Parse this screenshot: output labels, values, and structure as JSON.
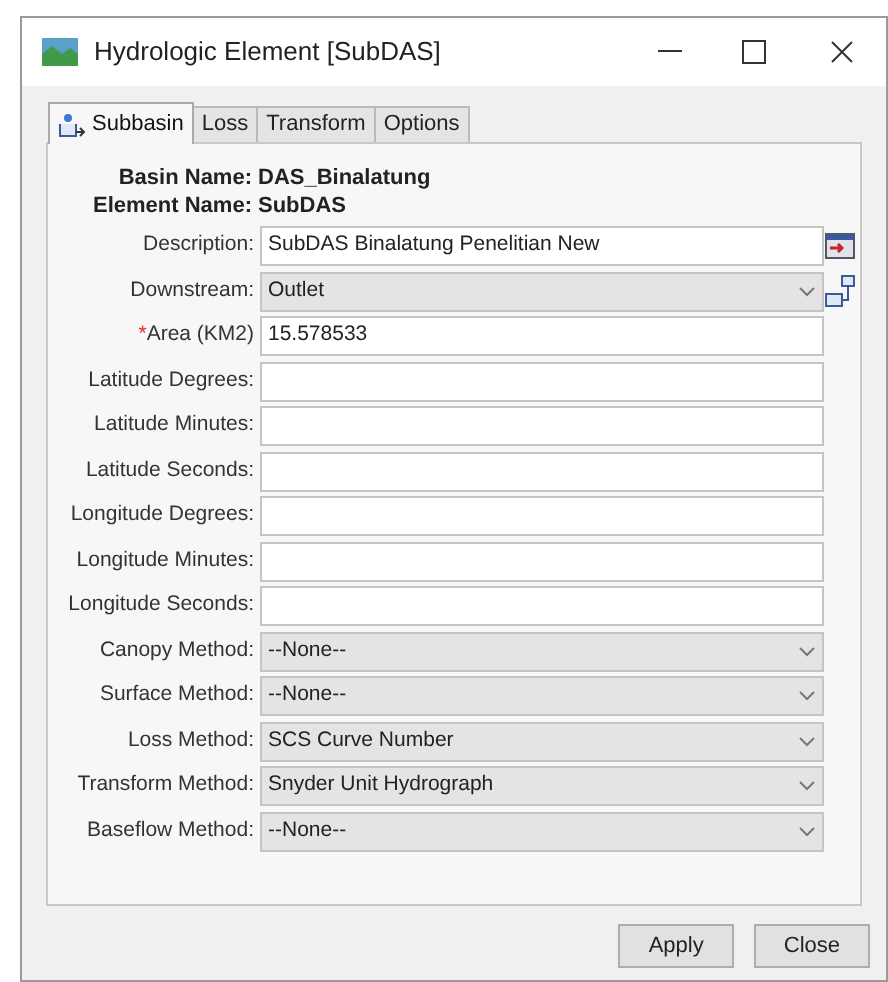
{
  "window": {
    "title": "Hydrologic Element [SubDAS]"
  },
  "tabs": [
    {
      "label": "Subbasin",
      "selected": true,
      "icon": true
    },
    {
      "label": "Loss",
      "selected": false
    },
    {
      "label": "Transform",
      "selected": false
    },
    {
      "label": "Options",
      "selected": false
    }
  ],
  "header": [
    {
      "label": "Basin Name:",
      "value": "DAS_Binalatung"
    },
    {
      "label": "Element Name:",
      "value": "SubDAS"
    }
  ],
  "fields": [
    {
      "label": "Description:",
      "kind": "text",
      "value": "SubDAS Binalatung Penelitian New",
      "side_button": {
        "kind": "form"
      }
    },
    {
      "label": "Downstream:",
      "kind": "select",
      "value": "Outlet",
      "side_button": {
        "kind": "database"
      }
    },
    {
      "label": "Area (KM2)",
      "kind": "text",
      "value": "15.578533",
      "required_mark": "*"
    },
    {
      "label": "Latitude Degrees:",
      "kind": "text"
    },
    {
      "label": "Latitude Minutes:",
      "kind": "text"
    },
    {
      "label": "Latitude Seconds:",
      "kind": "text"
    },
    {
      "label": "Longitude Degrees:",
      "kind": "text"
    },
    {
      "label": "Longitude Minutes:",
      "kind": "text"
    },
    {
      "label": "Longitude Seconds:",
      "kind": "text"
    },
    {
      "label": "Canopy Method:",
      "kind": "select",
      "value": "--None--"
    },
    {
      "label": "Surface Method:",
      "kind": "select",
      "value": "--None--"
    },
    {
      "label": "Loss Method:",
      "kind": "select",
      "value": "SCS Curve Number"
    },
    {
      "label": "Transform Method:",
      "kind": "select",
      "value": "Snyder Unit Hydrograph"
    },
    {
      "label": "Baseflow Method:",
      "kind": "select",
      "value": "--None--"
    }
  ],
  "buttons": [
    "Apply",
    "Close"
  ]
}
